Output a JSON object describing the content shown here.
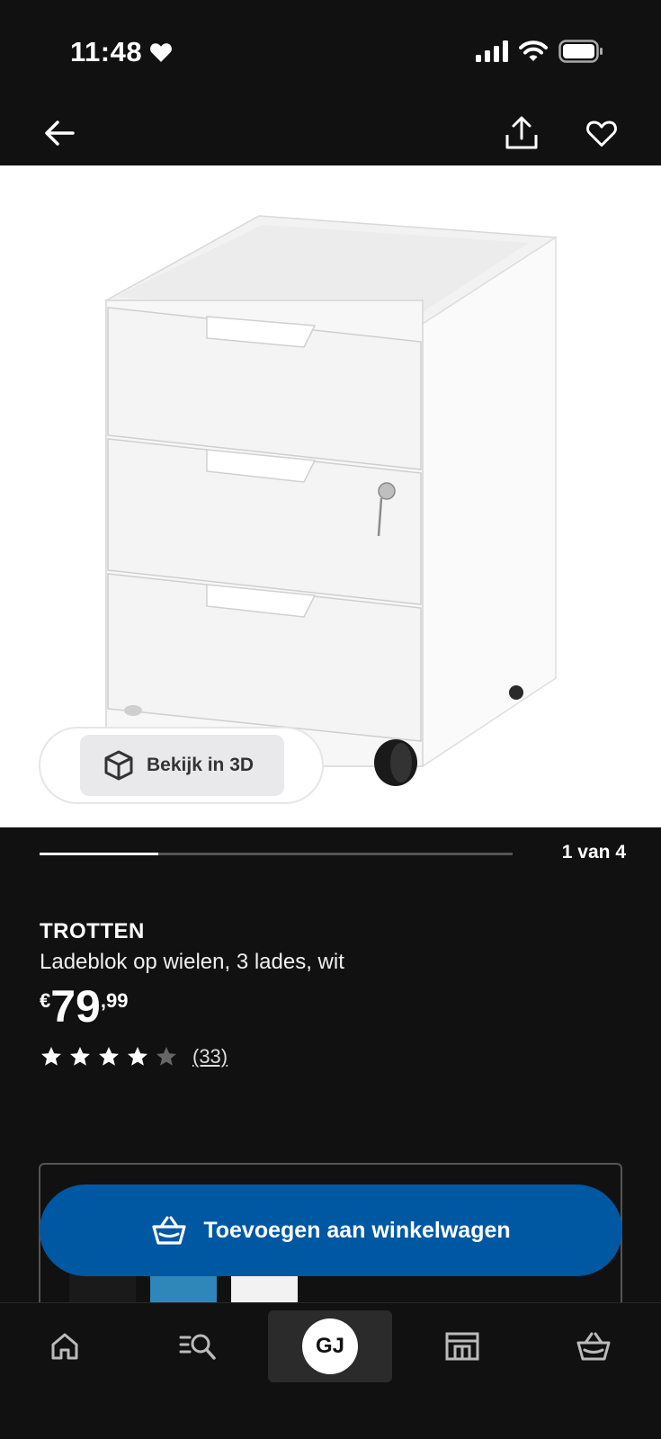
{
  "status_bar": {
    "time": "11:48"
  },
  "hero": {
    "view3d_label": "Bekijk in 3D"
  },
  "gallery": {
    "counter": "1 van 4",
    "progress": 0.25
  },
  "product": {
    "name": "TROTTEN",
    "description": "Ladeblok op wielen, 3 lades, wit",
    "price_currency": "€",
    "price_integer": "79",
    "price_decimal": ",99",
    "rating": 4,
    "rating_max": 5,
    "review_count": "(33)"
  },
  "variants": [
    {
      "color": "#1a1a1a"
    },
    {
      "color": "#2f86b8"
    },
    {
      "color": "#f2f2f2"
    }
  ],
  "cta": {
    "add_to_cart_label": "Toevoegen aan winkelwagen"
  },
  "bottom_nav": {
    "avatar_initials": "GJ"
  },
  "colors": {
    "accent": "#0058a3",
    "background": "#111111"
  }
}
